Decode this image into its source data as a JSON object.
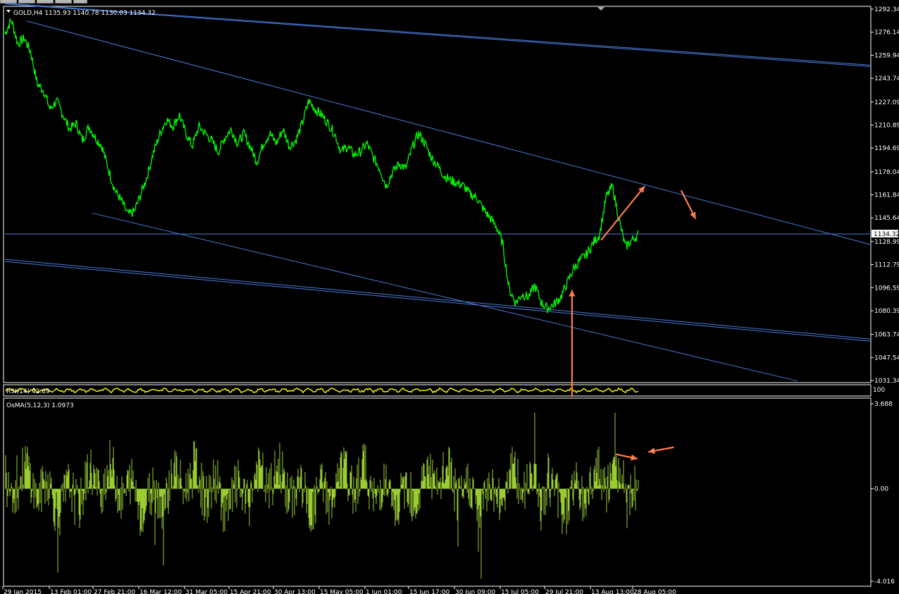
{
  "window": {
    "symbol_header": "GOLD,H4  1135.93 1140.78 1130.03 1134.32",
    "osma_header": "OsMA(5,12,3) 1.0973",
    "rsi_header": "RSI(14) 42.89",
    "current_price_label": "1134.32"
  },
  "colors": {
    "background": "#000000",
    "price_line": "#00ff00",
    "trendline": "#4a7bd8",
    "rsi_line": "#ffff00",
    "osma_bars": "#9acd32",
    "annotation_arrow": "#ff7f50",
    "grid_border": "#ffffff"
  },
  "chart_data": [
    {
      "type": "line",
      "title": "GOLD,H4  1135.93 1140.78 1130.03 1134.32",
      "price_ticks": [
        "1292.34",
        "1276.14",
        "1259.94",
        "1243.74",
        "1227.09",
        "1210.89",
        "1194.69",
        "1178.04",
        "1161.84",
        "1145.64",
        "1128.99",
        "1112.79",
        "1096.59",
        "1080.39",
        "1063.74",
        "1047.54",
        "1031.34"
      ],
      "time_ticks": [
        "29 Jan 2015",
        "13 Feb 01:00",
        "27 Feb 21:00",
        "16 Mar 12:00",
        "31 Mar 05:00",
        "15 Apr 21:00",
        "30 Apr 13:00",
        "15 May 05:00",
        "1 Jun 01:00",
        "15 Jun 17:00",
        "30 Jun 09:00",
        "15 Jul 05:00",
        "29 Jul 21:00",
        "13 Aug 13:00",
        "28 Aug 05:00"
      ],
      "ylim": [
        1031.34,
        1292.34
      ],
      "current_price": 1134.32,
      "series": [
        {
          "values": [
            1275,
            1285,
            1268,
            1272,
            1262,
            1240,
            1235,
            1222,
            1228,
            1218,
            1208,
            1212,
            1200,
            1210,
            1202,
            1196,
            1180,
            1165,
            1158,
            1148,
            1150,
            1162,
            1175,
            1192,
            1205,
            1215,
            1210,
            1218,
            1205,
            1196,
            1210,
            1205,
            1200,
            1192,
            1202,
            1208,
            1198,
            1205,
            1195,
            1185,
            1198,
            1205,
            1198,
            1208,
            1196,
            1200,
            1212,
            1228,
            1222,
            1218,
            1212,
            1205,
            1192,
            1196,
            1190,
            1192,
            1198,
            1188,
            1180,
            1168,
            1178,
            1184,
            1180,
            1195,
            1205,
            1198,
            1188,
            1182,
            1175,
            1172,
            1170,
            1168,
            1162,
            1160,
            1152,
            1146,
            1140,
            1128,
            1096,
            1086,
            1092,
            1090,
            1098,
            1086,
            1082,
            1085,
            1090,
            1100,
            1110,
            1116,
            1120,
            1128,
            1134,
            1160,
            1168,
            1145,
            1125,
            1130,
            1134
          ]
        }
      ],
      "trendlines": [
        {
          "name": "upper-outer",
          "points": [
            [
              0,
              1296
            ],
            [
              119,
              1252
            ]
          ]
        },
        {
          "name": "upper-outer-2",
          "points": [
            [
              0,
              1296.5
            ],
            [
              119,
              1253
            ]
          ]
        },
        {
          "name": "channel-upper",
          "points": [
            [
              3,
              1284
            ],
            [
              119,
              1127
            ]
          ]
        },
        {
          "name": "channel-lower",
          "points": [
            [
              12,
              1149
            ],
            [
              109,
              1031
            ]
          ]
        },
        {
          "name": "lower-outer",
          "points": [
            [
              0,
              1115
            ],
            [
              119,
              1059
            ]
          ]
        },
        {
          "name": "lower-outer-2",
          "points": [
            [
              0,
              1116.5
            ],
            [
              119,
              1060.5
            ]
          ]
        },
        {
          "name": "current-price-line",
          "points": [
            [
              0,
              1134.32
            ],
            [
              119,
              1134.32
            ]
          ]
        }
      ],
      "annotations": [
        {
          "name": "up-arrow-1",
          "from": [
            82,
            1130
          ],
          "to": [
            88,
            1168
          ]
        },
        {
          "name": "down-arrow-1",
          "from": [
            93,
            1165
          ],
          "to": [
            95,
            1145
          ]
        },
        {
          "name": "vertical-arrow",
          "from": [
            78,
            1020
          ],
          "to": [
            78,
            1095
          ]
        }
      ]
    },
    {
      "type": "line",
      "title": "RSI(14) 42.89",
      "ylim": [
        0,
        100
      ],
      "tick_labels": [
        "100"
      ]
    },
    {
      "type": "bar",
      "title": "OsMA(5,12,3) 1.0973",
      "ylim": [
        -4.016,
        3.688
      ],
      "tick_labels": [
        "3.688",
        "0.00",
        "-4.016"
      ],
      "annotations": [
        {
          "name": "osma-arrow-right",
          "from": [
            84,
            1.5
          ],
          "to": [
            87,
            1.3
          ]
        },
        {
          "name": "osma-arrow-left",
          "from": [
            92,
            1.8
          ],
          "to": [
            88.5,
            1.6
          ]
        }
      ]
    }
  ]
}
